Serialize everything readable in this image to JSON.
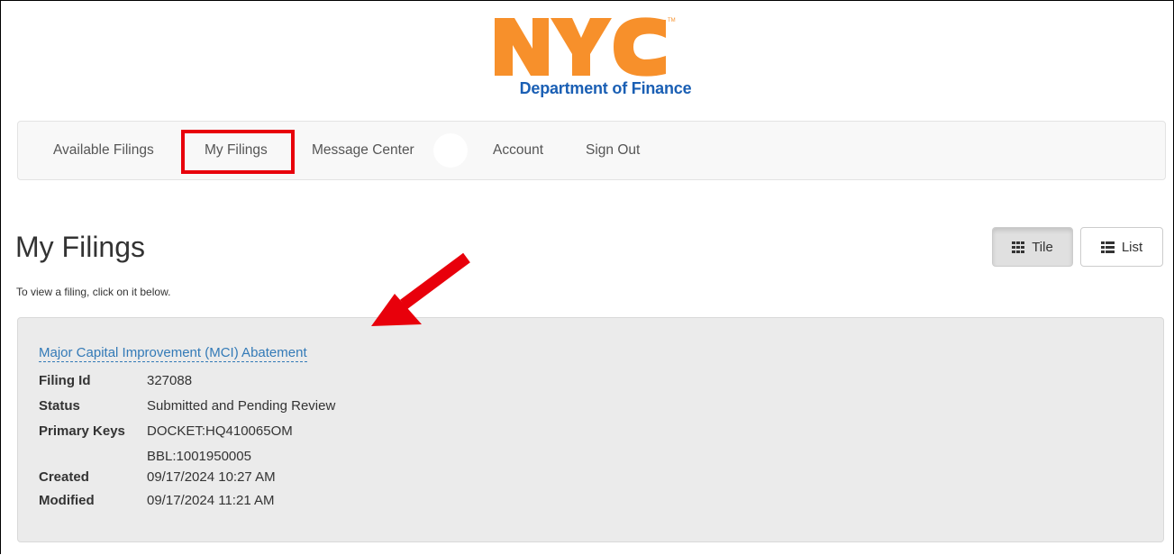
{
  "logo": {
    "text": "NYC",
    "department": "Department of Finance",
    "color": "#f7902b"
  },
  "nav": {
    "items": [
      {
        "label": "Available Filings"
      },
      {
        "label": "My Filings"
      },
      {
        "label": "Message Center"
      },
      {
        "label": "Account"
      },
      {
        "label": "Sign Out"
      }
    ],
    "highlight_color": "#e8000b"
  },
  "page": {
    "title": "My Filings",
    "hint": "To view a filing, click on it below."
  },
  "view_toggle": {
    "tile_label": "Tile",
    "list_label": "List",
    "active": "Tile"
  },
  "filing": {
    "name": "Major Capital Improvement (MCI) Abatement",
    "fields": {
      "filing_id_label": "Filing Id",
      "filing_id": "327088",
      "status_label": "Status",
      "status": "Submitted and Pending Review",
      "primary_keys_label": "Primary Keys",
      "primary_key_1": "DOCKET:HQ410065OM",
      "primary_key_2": "BBL:1001950005",
      "created_label": "Created",
      "created": "09/17/2024 10:27 AM",
      "modified_label": "Modified",
      "modified": "09/17/2024 11:21 AM"
    }
  },
  "annotation": {
    "arrow_color": "#e8000b"
  }
}
